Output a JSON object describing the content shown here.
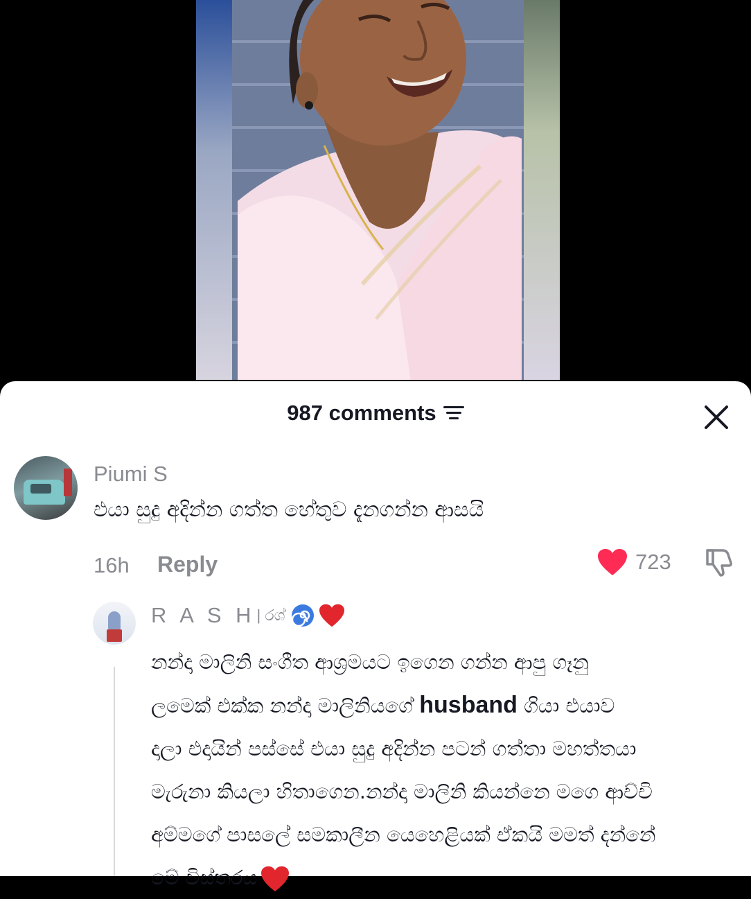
{
  "comments_panel": {
    "count_label": "987 comments"
  },
  "comment": {
    "username": "Piumi S",
    "text": "එයා සුදු අදින්න ගත්ත හේතුව දැනගන්න ආසයි",
    "time": "16h",
    "reply_label": "Reply",
    "like_count": "723"
  },
  "reply": {
    "username": "R A S H",
    "username_sep": "| රශ්",
    "lines": [
      "නන්දා මාලිනි සංගීත ආශ්‍රමයට ඉගෙන ගන්න ආපු ගෑනු",
      "ලමෙක් එක්ක නන්දා මාලිනියගේ",
      "husband",
      "ගියා එයාව",
      "දාලා එදායින් පස්සේ එයා සුදු අදින්න පටන් ගත්තා මහත්තයා",
      "මැරුනා කියලා හිතාගෙන.නන්දා මාලිනි කියන්නෙ මගෙ ආච්චි",
      "අම්මගේ පාසලේ සමකාලීන යෙහෙළියක් ඒකයි මමත් දන්නේ",
      "මේ විස්තරය"
    ]
  },
  "colors": {
    "like_red": "#fe2c55",
    "text_dark": "#161823",
    "text_gray": "#8a8b91"
  },
  "icons": [
    "filter-icon",
    "close-icon",
    "heart-icon",
    "dislike-icon",
    "spiral-emoji",
    "heart-emoji"
  ]
}
